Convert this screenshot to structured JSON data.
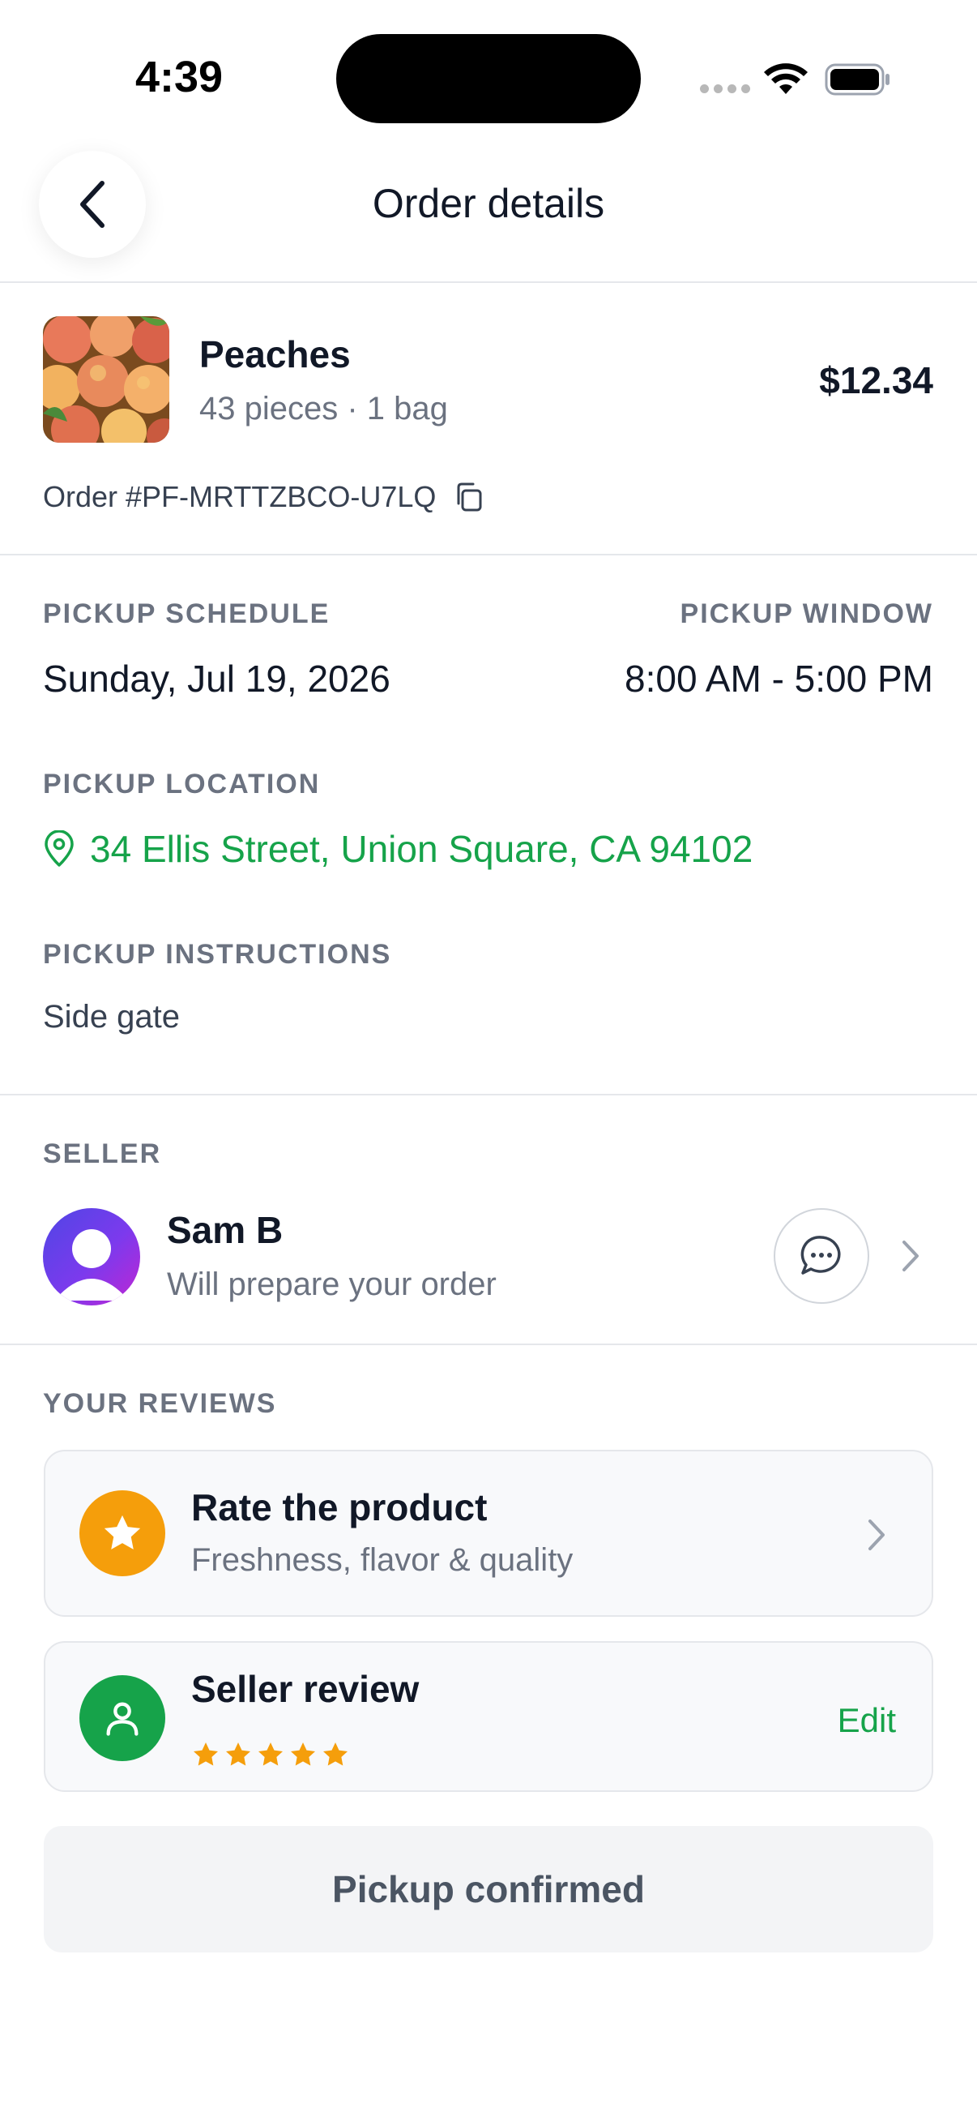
{
  "status_bar": {
    "time": "4:39"
  },
  "header": {
    "title": "Order details"
  },
  "product": {
    "name": "Peaches",
    "meta": "43 pieces · 1 bag",
    "price": "$12.34",
    "order_id": "Order #PF-MRTTZBCO-U7LQ"
  },
  "pickup": {
    "schedule_label": "PICKUP SCHEDULE",
    "schedule_value": "Sunday, Jul 19, 2026",
    "window_label": "PICKUP WINDOW",
    "window_value": "8:00 AM - 5:00 PM",
    "location_label": "PICKUP LOCATION",
    "location_value": "34 Ellis Street, Union Square, CA 94102",
    "instructions_label": "PICKUP INSTRUCTIONS",
    "instructions_value": "Side gate"
  },
  "seller": {
    "section_label": "SELLER",
    "name": "Sam B",
    "subtitle": "Will prepare your order"
  },
  "reviews": {
    "section_label": "YOUR REVIEWS",
    "rate_product": {
      "title": "Rate the product",
      "subtitle": "Freshness, flavor & quality"
    },
    "seller_review": {
      "title": "Seller review",
      "rating": 5,
      "edit_label": "Edit"
    }
  },
  "footer": {
    "button_label": "Pickup confirmed"
  },
  "colors": {
    "accent_green": "#16a34a",
    "star_orange": "#f59e0b",
    "avatar_purple": "#6d28d9"
  }
}
